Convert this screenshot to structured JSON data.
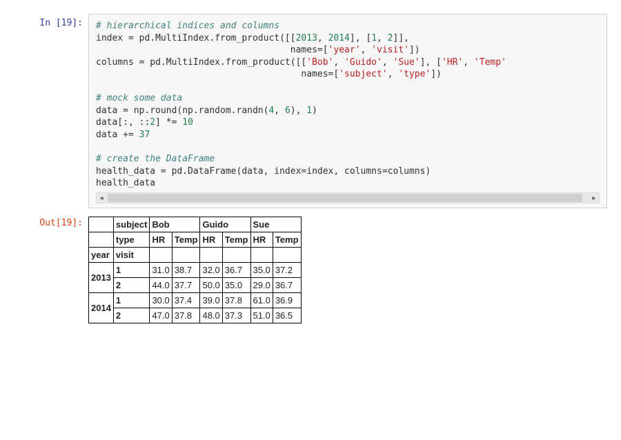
{
  "in_prompt": "In [19]:",
  "out_prompt": "Out[19]:",
  "code": {
    "c1": "# hierarchical indices and columns",
    "l2a": "index = pd.MultiIndex.from_product([[",
    "l2_y1": "2013",
    "l2_c1": ", ",
    "l2_y2": "2014",
    "l2b": "], [",
    "l2_v1": "1",
    "l2_c2": ", ",
    "l2_v2": "2",
    "l2c": "]],",
    "l3a": "                                    names=[",
    "l3_s1": "'year'",
    "l3_c": ", ",
    "l3_s2": "'visit'",
    "l3b": "])",
    "l4a": "columns = pd.MultiIndex.from_product([[",
    "l4_s1": "'Bob'",
    "l4_c1": ", ",
    "l4_s2": "'Guido'",
    "l4_c2": ", ",
    "l4_s3": "'Sue'",
    "l4b": "], [",
    "l4_s4": "'HR'",
    "l4_c3": ", ",
    "l4_s5": "'Temp'",
    "l5a": "                                      names=[",
    "l5_s1": "'subject'",
    "l5_c": ", ",
    "l5_s2": "'type'",
    "l5b": "])",
    "c2": "# mock some data",
    "l7a": "data = np.round(np.random.randn(",
    "l7_n1": "4",
    "l7_c1": ", ",
    "l7_n2": "6",
    "l7b": "), ",
    "l7_n3": "1",
    "l7c": ")",
    "l8a": "data[:, ::",
    "l8_n1": "2",
    "l8b": "] *= ",
    "l8_n2": "10",
    "l9a": "data += ",
    "l9_n1": "37",
    "c3": "# create the DataFrame",
    "l11": "health_data = pd.DataFrame(data, index=index, columns=columns)",
    "l12": "health_data"
  },
  "chart_data": {
    "type": "table",
    "col_level_names": [
      "subject",
      "type"
    ],
    "row_level_names": [
      "year",
      "visit"
    ],
    "subjects": [
      "Bob",
      "Guido",
      "Sue"
    ],
    "types": [
      "HR",
      "Temp"
    ],
    "years": [
      2013,
      2014
    ],
    "visits": [
      1,
      2
    ],
    "rows": [
      {
        "year": 2013,
        "visit": 1,
        "Bob_HR": 31.0,
        "Bob_Temp": 38.7,
        "Guido_HR": 32.0,
        "Guido_Temp": 36.7,
        "Sue_HR": 35.0,
        "Sue_Temp": 37.2
      },
      {
        "year": 2013,
        "visit": 2,
        "Bob_HR": 44.0,
        "Bob_Temp": 37.7,
        "Guido_HR": 50.0,
        "Guido_Temp": 35.0,
        "Sue_HR": 29.0,
        "Sue_Temp": 36.7
      },
      {
        "year": 2014,
        "visit": 1,
        "Bob_HR": 30.0,
        "Bob_Temp": 37.4,
        "Guido_HR": 39.0,
        "Guido_Temp": 37.8,
        "Sue_HR": 61.0,
        "Sue_Temp": 36.9
      },
      {
        "year": 2014,
        "visit": 2,
        "Bob_HR": 47.0,
        "Bob_Temp": 37.8,
        "Guido_HR": 48.0,
        "Guido_Temp": 37.3,
        "Sue_HR": 51.0,
        "Sue_Temp": 36.5
      }
    ]
  }
}
